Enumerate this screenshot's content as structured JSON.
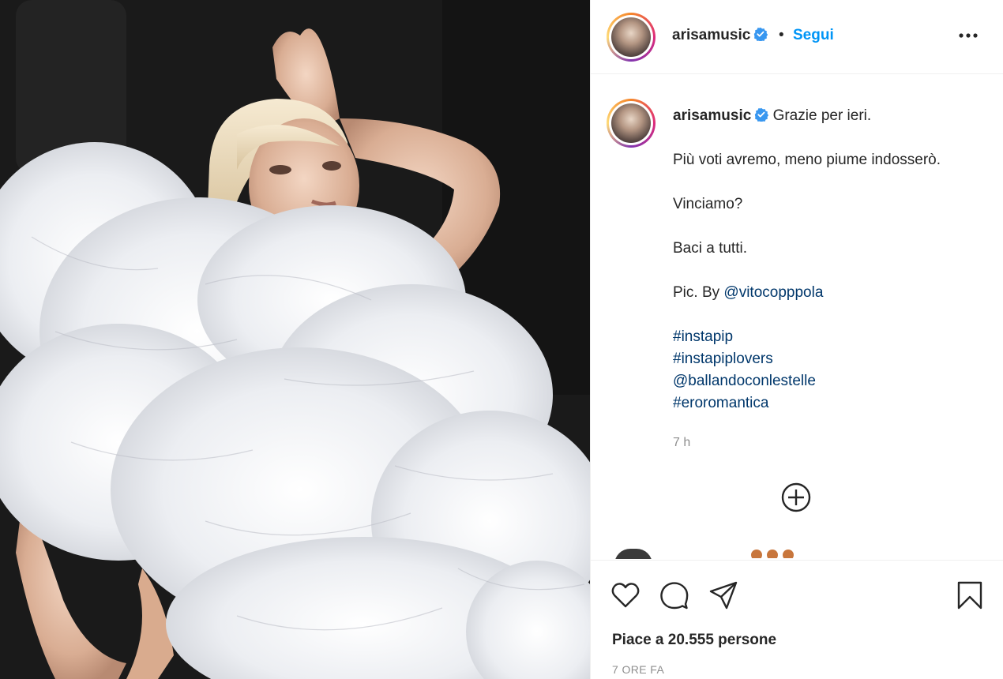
{
  "post": {
    "image_alt": "Photo of a woman with platinum blonde bob lying back wrapped in large white feather fans"
  },
  "header": {
    "username": "arisamusic",
    "separator": "•",
    "follow_label": "Segui",
    "more_icon": "more-horizontal-icon"
  },
  "caption": {
    "username": "arisamusic",
    "first_line": "Grazie per ieri.",
    "lines": [
      "Più voti avremo, meno piume indosserò.",
      "Vinciamo?",
      "Baci a tutti."
    ],
    "credit_prefix": "Pic. By ",
    "credit_mention": "@vitocopppola",
    "tags": [
      "#instapip",
      "#instapiplovers",
      "@ballandoconlestelle",
      "#eroromantica"
    ],
    "time": "7 h"
  },
  "comments": {
    "partial_comment": "",
    "load_more_icon": "plus-circle-icon"
  },
  "actions": {
    "like_icon": "heart-icon",
    "comment_icon": "comment-icon",
    "share_icon": "send-icon",
    "save_icon": "bookmark-icon",
    "likes_text": "Piace a 20.555 persone",
    "timestamp": "7 ORE FA"
  },
  "colors": {
    "accent": "#0095f6",
    "link": "#00376b",
    "muted": "#8e8e8e",
    "verified": "#3897f0"
  }
}
